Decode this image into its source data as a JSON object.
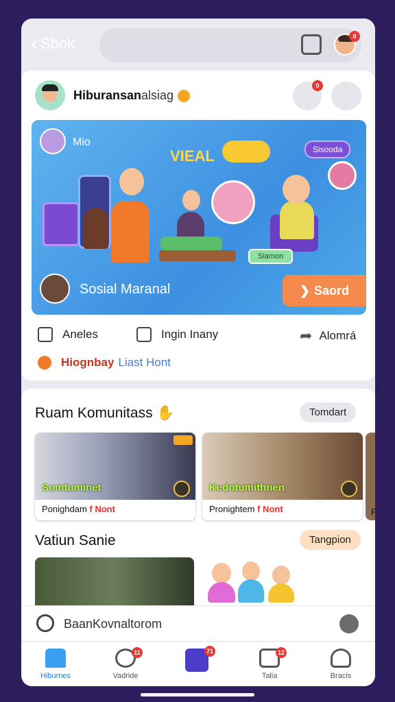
{
  "topbar": {
    "back_label": "Sbok",
    "notification_count": "0"
  },
  "post": {
    "author": "Hiburansan",
    "author_suffix": "alsiag",
    "header_badge_count": "0",
    "banner": {
      "mini_label": "Mio",
      "headline": "VIEAL",
      "tag": "Sisooda",
      "green_tag": "Siamon",
      "caption": "Sosial Maranal",
      "button": "Saord"
    },
    "actions": {
      "like": "Aneles",
      "comment": "Ingin Inany",
      "share": "Alomrá"
    },
    "highlight": {
      "part1": "Hiognbay",
      "part2": "Liast Hont"
    }
  },
  "community": {
    "title": "Ruam Komunitass",
    "pill": "Tomdart",
    "tiles": [
      {
        "label": "Somtuminet",
        "caption": "Ponighdam",
        "caption_tail": "f Nont"
      },
      {
        "label": "Kedotumithnen",
        "caption": "Pronightem",
        "caption_tail": "f Nont"
      }
    ],
    "stub_caption": "P",
    "section2_title": "Vatiun Sanie",
    "section2_pill": "Tangpion"
  },
  "search": {
    "placeholder": "BaanKovnaltorom"
  },
  "tabs": [
    {
      "label": "Hiburnes",
      "badge": ""
    },
    {
      "label": "Vadride",
      "badge": "11"
    },
    {
      "label": "",
      "badge": "71"
    },
    {
      "label": "Talia",
      "badge": "12"
    },
    {
      "label": "Bracis",
      "badge": ""
    }
  ],
  "colors": {
    "accent": "#1f7ad8",
    "background": "#2e1d5c",
    "cta": "#f58a4c",
    "badge": "#e53935"
  }
}
